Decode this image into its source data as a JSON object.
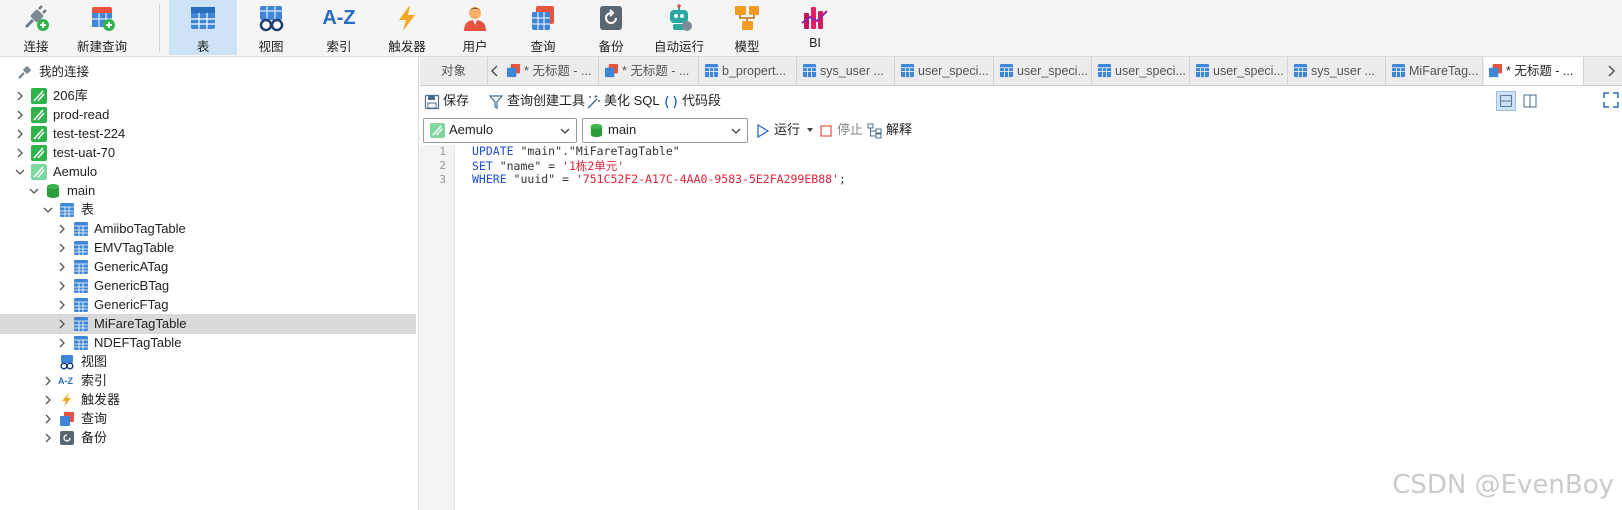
{
  "toolbar": {
    "items": [
      {
        "label": "连接",
        "icon": "connect-plug-icon"
      },
      {
        "label": "新建查询",
        "icon": "new-query-icon"
      },
      {
        "label": "表",
        "icon": "table-icon",
        "active": true
      },
      {
        "label": "视图",
        "icon": "view-glasses-icon"
      },
      {
        "label": "索引",
        "icon": "index-az-icon"
      },
      {
        "label": "触发器",
        "icon": "trigger-bolt-icon"
      },
      {
        "label": "用户",
        "icon": "user-icon"
      },
      {
        "label": "查询",
        "icon": "query-icon"
      },
      {
        "label": "备份",
        "icon": "backup-icon"
      },
      {
        "label": "自动运行",
        "icon": "robot-icon"
      },
      {
        "label": "模型",
        "icon": "model-icon"
      },
      {
        "label": "BI",
        "icon": "bi-chart-icon"
      }
    ]
  },
  "tree": {
    "header": "我的连接",
    "connections": [
      "206库",
      "prod-read",
      "test-test-224",
      "test-uat-70"
    ],
    "open_connection": "Aemulo",
    "database": "main",
    "tables_group": "表",
    "tables": [
      "AmiiboTagTable",
      "EMVTagTable",
      "GenericATag",
      "GenericBTag",
      "GenericFTag",
      "MiFareTagTable",
      "NDEFTagTable"
    ],
    "selected_table": "MiFareTagTable",
    "groups": [
      "视图",
      "索引",
      "触发器",
      "查询",
      "备份"
    ]
  },
  "tabs": {
    "objects_label": "对象",
    "items": [
      "* 无标题 - ...",
      "* 无标题 - ...",
      "b_propert...",
      "sys_user ...",
      "user_speci...",
      "user_speci...",
      "user_speci...",
      "user_speci...",
      "sys_user ...",
      "MiFareTag...",
      "* 无标题 - ..."
    ]
  },
  "actions": {
    "save": "保存",
    "query_builder": "查询创建工具",
    "beautify": "美化 SQL",
    "snippet": "代码段"
  },
  "selectors": {
    "connection": "Aemulo",
    "database": "main",
    "run": "运行",
    "stop": "停止",
    "explain": "解释"
  },
  "editor": {
    "line_numbers": [
      "1",
      "2",
      "3"
    ],
    "line1": {
      "kw": "UPDATE",
      "rest": " \"main\".\"MiFareTagTable\""
    },
    "line2": {
      "kw": "SET",
      "mid": " \"name\" = ",
      "str": "'1栋2单元'"
    },
    "line3": {
      "kw": "WHERE",
      "mid": " \"uuid\" = ",
      "str": "'751C52F2-A17C-4AA0-9583-5E2FA299EB88'",
      "end": ";"
    }
  },
  "watermark": "CSDN @EvenBoy",
  "colors": {
    "accent": "#1f4fd6",
    "string": "#e0243b",
    "active_tab_bg": "#cfe3f7",
    "selected_row": "#dadada"
  }
}
